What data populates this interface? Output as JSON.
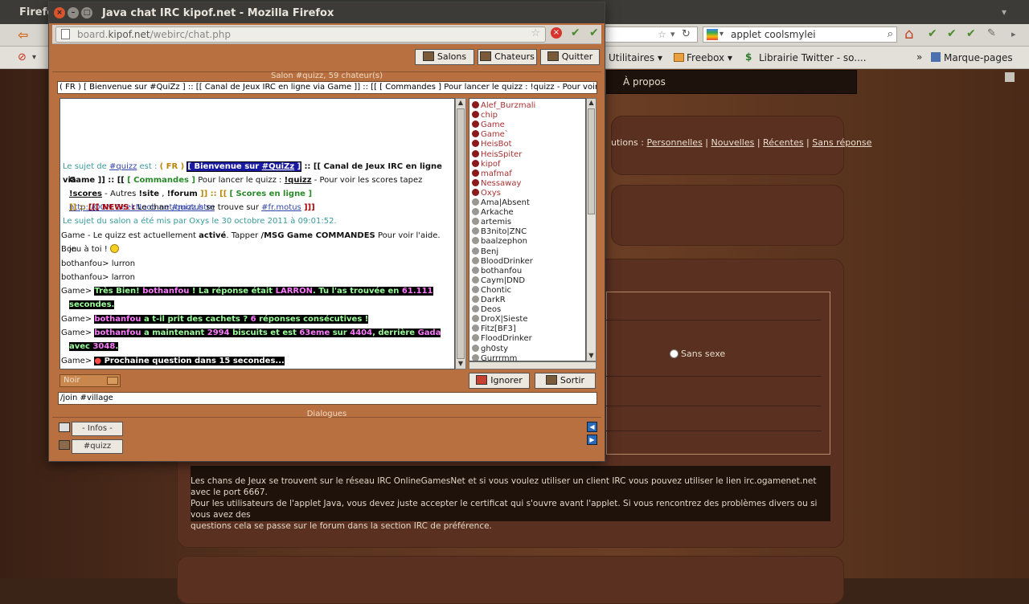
{
  "background": {
    "title_fragment": "Firefo",
    "search_value": "applet coolsmylei",
    "bookmarks": [
      "Utilitaires ▾",
      "Freebox ▾",
      "Librairie Twitter - so....",
      "»",
      "Marque-pages"
    ],
    "menu_item": "À propos",
    "links_prefix": "utions :",
    "links": [
      "Personnelles",
      "Nouvelles",
      "Récentes",
      "Sans réponse"
    ],
    "radio_label": "Sans sexe",
    "info_text": "Les chans de Jeux se trouvent sur le réseau IRC OnlineGamesNet et si vous voulez utiliser un client IRC vous pouvez utiliser le lien irc.ogamenet.net avec le port 6667.\nPour les utilisateurs de l'applet Java, vous devez juste accepter le certificat qui s'ouvre avant l'applet. Si vous rencontrez des problèmes divers ou si vous avez des\nquestions cela se passe sur le forum dans la section IRC de préférence."
  },
  "window": {
    "title": "Java chat IRC kipof.net - Mozilla Firefox",
    "address_pre": "board.",
    "address_host": "kipof.net",
    "address_path": "/webirc/chat.php"
  },
  "applet": {
    "buttons": {
      "salons": "Salons",
      "chateurs": "Chateurs",
      "quitter": "Quitter",
      "ignorer": "Ignorer",
      "sortir": "Sortir"
    },
    "salon_label": "Salon #quizz, 59 chateur(s)",
    "topic": "( FR ) [ Bienvenue sur #QuiZz ] :: [[ Canal de Jeux IRC en ligne via Game ]] :: [[ [ Commandes ] Pour lancer le quizz : !quizz - Pour voir les scores tapez !scores - Autres !site , !forum ]]",
    "color_select": "Noir",
    "command_input": "/join #village",
    "dialogues_label": "Dialogues",
    "tabs": {
      "infos": "- Infos -",
      "quizz": "#quizz"
    },
    "chat": {
      "topic_prefix": "Le sujet de",
      "channel": "#quizz",
      "topic_is": "est :",
      "fr": "( FR )",
      "welcome_a": "[ Bienvenue sur",
      "welcome_b": "#QuiZz",
      "welcome_c": "]",
      "canal": ":: [[ Canal de Jeux IRC en ligne via",
      "canal_b": "Game ]] :: [[",
      "commandes": "[ Commandes ]",
      "pour_lancer": "Pour lancer le quizz :",
      "quizz_cmd": "!quizz",
      "pour_voir": "- Pour voir les scores tapez",
      "scores_cmd": "!scores",
      "autres": "- Autres",
      "site_cmd": "!site",
      "comma": ",",
      "forum_cmd": "!forum",
      "close1": "]] :: [[",
      "scores_en_ligne": "[ Scores en ligne ]",
      "url": "http://OGN.GeekNoob.net/quizz.htm",
      "close2": "]] ::",
      "news": "[[[ NEWS :",
      "le_chan": "Le chan",
      "motus": "#motus",
      "se_trouve": "se trouve sur",
      "fr_motus": "#fr.motus",
      "close3": "]]]",
      "set_by": "Le sujet du salon a été mis par Oxys le 30 octobre 2011 à 09:01:52.",
      "game_msg_a": "Game - Le quizz est actuellement",
      "game_msg_b": "activé",
      "game_msg_c": ". Tapper",
      "game_msg_d": "/MSG Game COMMANDES",
      "game_msg_e": "Pour voir l'aide. Bon",
      "game_msg_f": "jeu à toi !",
      "line_lurron": "bothanfou> lurron",
      "line_larron": "bothanfou> larron",
      "game_prefix": "Game>",
      "tres_bien_a": "Très Bien!",
      "tres_bien_b": "bothanfou",
      "tres_bien_c": "! La réponse était",
      "tres_bien_d": "LARRON",
      "tres_bien_e": ". Tu l'as trouvée en",
      "tres_bien_f": "61.111",
      "tres_bien_g": "secondes.",
      "cachets_a": "bothanfou",
      "cachets_b": "a t-il prit des cachets ?",
      "cachets_c": "6",
      "cachets_d": "réponses consécutives !",
      "biscuits_a": "bothanfou",
      "biscuits_b": "a maintenant",
      "biscuits_c": "2994",
      "biscuits_d": "biscuits et est",
      "biscuits_e": "63eme",
      "biscuits_f": "sur",
      "biscuits_g": "4404",
      "biscuits_h": ", derrière",
      "biscuits_i": "Gada",
      "biscuits_j": "avec",
      "biscuits_k": "3048",
      "biscuits_l": ".",
      "prochaine": "Prochaine question dans 15 secondes..."
    },
    "users": [
      {
        "name": "Alef_Burzmali",
        "op": true
      },
      {
        "name": "chip",
        "op": true
      },
      {
        "name": "Game",
        "op": true
      },
      {
        "name": "Game`",
        "op": true
      },
      {
        "name": "HeisBot",
        "op": true
      },
      {
        "name": "HeisSpiter",
        "op": true
      },
      {
        "name": "kipof",
        "op": true
      },
      {
        "name": "mafmaf",
        "op": true
      },
      {
        "name": "Nessaway",
        "op": true
      },
      {
        "name": "Oxys",
        "op": true
      },
      {
        "name": "Ama|Absent",
        "op": false
      },
      {
        "name": "Arkache",
        "op": false
      },
      {
        "name": "artemis",
        "op": false
      },
      {
        "name": "B3nito|ZNC",
        "op": false
      },
      {
        "name": "baalzephon",
        "op": false
      },
      {
        "name": "Benj",
        "op": false
      },
      {
        "name": "BloodDrinker",
        "op": false
      },
      {
        "name": "bothanfou",
        "op": false
      },
      {
        "name": "Caym|DND",
        "op": false
      },
      {
        "name": "Chontic",
        "op": false
      },
      {
        "name": "DarkR",
        "op": false
      },
      {
        "name": "Deos",
        "op": false
      },
      {
        "name": "DroX|Sieste",
        "op": false
      },
      {
        "name": "Fitz[BF3]",
        "op": false
      },
      {
        "name": "FloodDrinker",
        "op": false
      },
      {
        "name": "gh0sty",
        "op": false
      },
      {
        "name": "Gurrrmm",
        "op": false
      }
    ]
  }
}
